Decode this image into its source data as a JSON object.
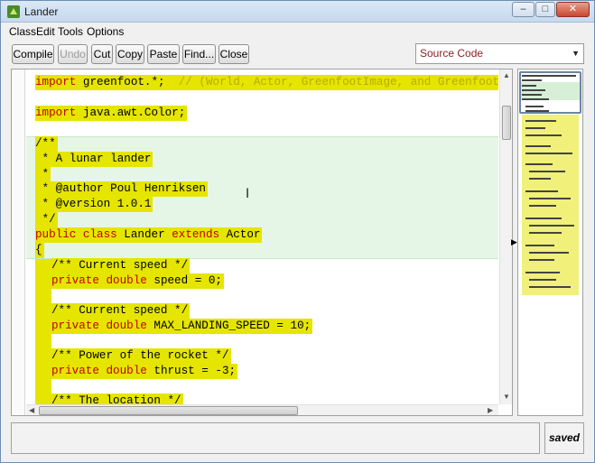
{
  "window": {
    "title": "Lander",
    "minimize_glyph": "–",
    "maximize_glyph": "□",
    "close_glyph": "✕"
  },
  "menu": {
    "items": [
      "Class",
      "Edit",
      "Tools",
      "Options"
    ]
  },
  "toolbar": {
    "compile": "Compile",
    "undo": "Undo",
    "cut": "Cut",
    "copy": "Copy",
    "paste": "Paste",
    "find": "Find...",
    "close": "Close"
  },
  "view_selector": {
    "selected": "Source Code"
  },
  "code": {
    "l1_kw": "import",
    "l1_rest": " greenfoot.*;  ",
    "l1_comment": "// (World, Actor, GreenfootImage, and Greenfoot)",
    "l2_kw": "import",
    "l2_rest": " java.awt.Color;",
    "l3": "/**",
    "l4": " * A lunar lander",
    "l5": " *",
    "l6": " * @author Poul Henriksen",
    "l7": " * @version 1.0.1",
    "l8": " */",
    "l9_kw1": "public",
    "l9_kw2": "class",
    "l9_name": "Lander",
    "l9_kw3": "extends",
    "l9_super": "Actor",
    "l10": "{",
    "l11": "/** Current speed */",
    "l12_kw1": "private",
    "l12_kw2": "double",
    "l12_rest": " speed = 0;",
    "l13": "/** Current speed */",
    "l14_kw1": "private",
    "l14_kw2": "double",
    "l14_rest": " MAX_LANDING_SPEED = 10;",
    "l15": "/** Power of the rocket */",
    "l16_kw1": "private",
    "l16_kw2": "double",
    "l16_rest": " thrust = -3;",
    "l17": "/** The location */"
  },
  "status": {
    "message": "",
    "saved": "saved"
  },
  "icons": {
    "app": "greenfoot-icon",
    "cursor": "text-cursor-icon",
    "collapse": "collapse-arrow-icon"
  },
  "colors": {
    "keyword": "#c00000",
    "comment": "#bba80a",
    "scope_highlight": "#e5e500",
    "class_scope": "#e6f6e6"
  }
}
